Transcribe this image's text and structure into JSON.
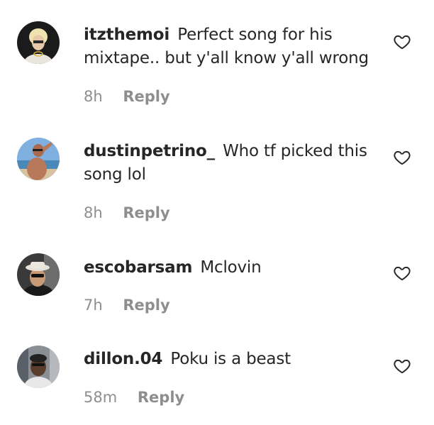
{
  "comments": [
    {
      "username": "itzthemoi",
      "text": "Perfect song for his mixtape.. but y'all know y'all wrong",
      "time": "8h",
      "reply_label": "Reply",
      "avatar_icon": "avatar-blonde-person"
    },
    {
      "username": "dustinpetrino_",
      "text": "Who tf picked this song lol",
      "time": "8h",
      "reply_label": "Reply",
      "avatar_icon": "avatar-beach-person"
    },
    {
      "username": "escobarsam",
      "text": "Mclovin",
      "time": "7h",
      "reply_label": "Reply",
      "avatar_icon": "avatar-hat-sunglasses-person"
    },
    {
      "username": "dillon.04",
      "text": "Poku is a beast",
      "time": "58m",
      "reply_label": "Reply",
      "avatar_icon": "avatar-crowd-person"
    }
  ],
  "colors": {
    "text": "#262626",
    "secondary": "#8e8e8e",
    "background": "#ffffff"
  },
  "icons": {
    "like": "heart-outline-icon"
  }
}
